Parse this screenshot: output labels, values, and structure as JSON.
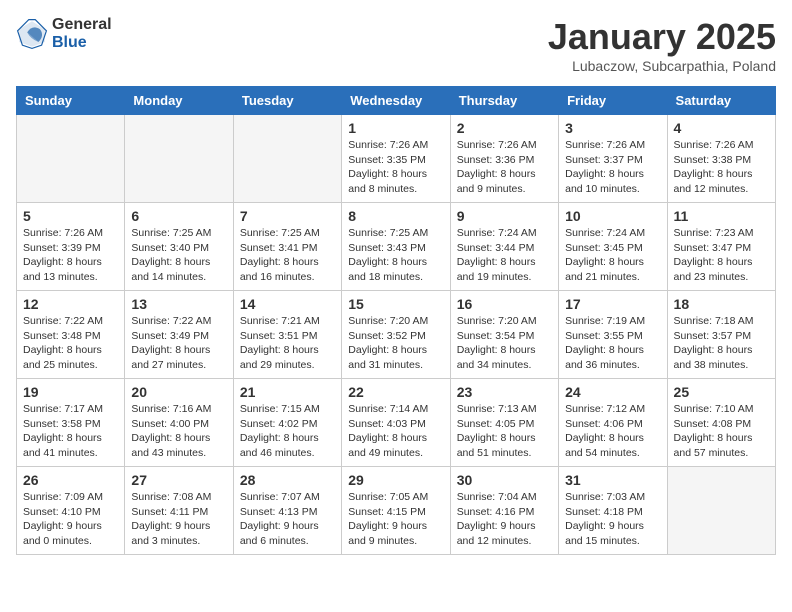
{
  "header": {
    "logo_general": "General",
    "logo_blue": "Blue",
    "month": "January 2025",
    "location": "Lubaczow, Subcarpathia, Poland"
  },
  "weekdays": [
    "Sunday",
    "Monday",
    "Tuesday",
    "Wednesday",
    "Thursday",
    "Friday",
    "Saturday"
  ],
  "weeks": [
    [
      {
        "day": "",
        "info": ""
      },
      {
        "day": "",
        "info": ""
      },
      {
        "day": "",
        "info": ""
      },
      {
        "day": "1",
        "info": "Sunrise: 7:26 AM\nSunset: 3:35 PM\nDaylight: 8 hours\nand 8 minutes."
      },
      {
        "day": "2",
        "info": "Sunrise: 7:26 AM\nSunset: 3:36 PM\nDaylight: 8 hours\nand 9 minutes."
      },
      {
        "day": "3",
        "info": "Sunrise: 7:26 AM\nSunset: 3:37 PM\nDaylight: 8 hours\nand 10 minutes."
      },
      {
        "day": "4",
        "info": "Sunrise: 7:26 AM\nSunset: 3:38 PM\nDaylight: 8 hours\nand 12 minutes."
      }
    ],
    [
      {
        "day": "5",
        "info": "Sunrise: 7:26 AM\nSunset: 3:39 PM\nDaylight: 8 hours\nand 13 minutes."
      },
      {
        "day": "6",
        "info": "Sunrise: 7:25 AM\nSunset: 3:40 PM\nDaylight: 8 hours\nand 14 minutes."
      },
      {
        "day": "7",
        "info": "Sunrise: 7:25 AM\nSunset: 3:41 PM\nDaylight: 8 hours\nand 16 minutes."
      },
      {
        "day": "8",
        "info": "Sunrise: 7:25 AM\nSunset: 3:43 PM\nDaylight: 8 hours\nand 18 minutes."
      },
      {
        "day": "9",
        "info": "Sunrise: 7:24 AM\nSunset: 3:44 PM\nDaylight: 8 hours\nand 19 minutes."
      },
      {
        "day": "10",
        "info": "Sunrise: 7:24 AM\nSunset: 3:45 PM\nDaylight: 8 hours\nand 21 minutes."
      },
      {
        "day": "11",
        "info": "Sunrise: 7:23 AM\nSunset: 3:47 PM\nDaylight: 8 hours\nand 23 minutes."
      }
    ],
    [
      {
        "day": "12",
        "info": "Sunrise: 7:22 AM\nSunset: 3:48 PM\nDaylight: 8 hours\nand 25 minutes."
      },
      {
        "day": "13",
        "info": "Sunrise: 7:22 AM\nSunset: 3:49 PM\nDaylight: 8 hours\nand 27 minutes."
      },
      {
        "day": "14",
        "info": "Sunrise: 7:21 AM\nSunset: 3:51 PM\nDaylight: 8 hours\nand 29 minutes."
      },
      {
        "day": "15",
        "info": "Sunrise: 7:20 AM\nSunset: 3:52 PM\nDaylight: 8 hours\nand 31 minutes."
      },
      {
        "day": "16",
        "info": "Sunrise: 7:20 AM\nSunset: 3:54 PM\nDaylight: 8 hours\nand 34 minutes."
      },
      {
        "day": "17",
        "info": "Sunrise: 7:19 AM\nSunset: 3:55 PM\nDaylight: 8 hours\nand 36 minutes."
      },
      {
        "day": "18",
        "info": "Sunrise: 7:18 AM\nSunset: 3:57 PM\nDaylight: 8 hours\nand 38 minutes."
      }
    ],
    [
      {
        "day": "19",
        "info": "Sunrise: 7:17 AM\nSunset: 3:58 PM\nDaylight: 8 hours\nand 41 minutes."
      },
      {
        "day": "20",
        "info": "Sunrise: 7:16 AM\nSunset: 4:00 PM\nDaylight: 8 hours\nand 43 minutes."
      },
      {
        "day": "21",
        "info": "Sunrise: 7:15 AM\nSunset: 4:02 PM\nDaylight: 8 hours\nand 46 minutes."
      },
      {
        "day": "22",
        "info": "Sunrise: 7:14 AM\nSunset: 4:03 PM\nDaylight: 8 hours\nand 49 minutes."
      },
      {
        "day": "23",
        "info": "Sunrise: 7:13 AM\nSunset: 4:05 PM\nDaylight: 8 hours\nand 51 minutes."
      },
      {
        "day": "24",
        "info": "Sunrise: 7:12 AM\nSunset: 4:06 PM\nDaylight: 8 hours\nand 54 minutes."
      },
      {
        "day": "25",
        "info": "Sunrise: 7:10 AM\nSunset: 4:08 PM\nDaylight: 8 hours\nand 57 minutes."
      }
    ],
    [
      {
        "day": "26",
        "info": "Sunrise: 7:09 AM\nSunset: 4:10 PM\nDaylight: 9 hours\nand 0 minutes."
      },
      {
        "day": "27",
        "info": "Sunrise: 7:08 AM\nSunset: 4:11 PM\nDaylight: 9 hours\nand 3 minutes."
      },
      {
        "day": "28",
        "info": "Sunrise: 7:07 AM\nSunset: 4:13 PM\nDaylight: 9 hours\nand 6 minutes."
      },
      {
        "day": "29",
        "info": "Sunrise: 7:05 AM\nSunset: 4:15 PM\nDaylight: 9 hours\nand 9 minutes."
      },
      {
        "day": "30",
        "info": "Sunrise: 7:04 AM\nSunset: 4:16 PM\nDaylight: 9 hours\nand 12 minutes."
      },
      {
        "day": "31",
        "info": "Sunrise: 7:03 AM\nSunset: 4:18 PM\nDaylight: 9 hours\nand 15 minutes."
      },
      {
        "day": "",
        "info": ""
      }
    ]
  ]
}
